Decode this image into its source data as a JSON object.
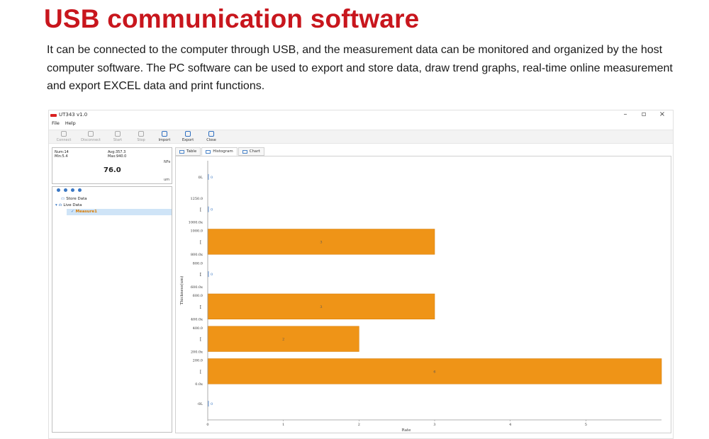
{
  "headline": "USB communication software",
  "description": "It can be connected to the computer through USB, and the measurement data can be monitored and organized by the host computer software. The PC software can be used to export and store data, draw trend graphs, real-time online measurement and export EXCEL data and print functions.",
  "window": {
    "title": "UT343 v1.0",
    "controls": {
      "minimize": "–",
      "maximize": "▫",
      "close": "×"
    }
  },
  "menu": [
    "File",
    "Help"
  ],
  "toolbar": [
    {
      "label": "Connect",
      "enabled": false
    },
    {
      "label": "Disconnect",
      "enabled": false
    },
    {
      "label": "Start",
      "enabled": false
    },
    {
      "label": "Stop",
      "enabled": false
    },
    {
      "label": "Import",
      "enabled": true
    },
    {
      "label": "Export",
      "enabled": true
    },
    {
      "label": "Close",
      "enabled": true
    }
  ],
  "measurement": {
    "num": "Num:14",
    "min": "Min:5.4",
    "avg": "Avg:357.3",
    "max": "Max:940.0",
    "mode": "NFe",
    "value": "76.0",
    "unit": "um"
  },
  "tree": {
    "store_data": "Store Data",
    "live_data": "Live Data",
    "measure": "Measure1"
  },
  "tabs": [
    "Table",
    "Histogram",
    "Chart"
  ],
  "chart_data": {
    "type": "bar",
    "orientation": "horizontal",
    "xlabel": "Rate",
    "ylabel": "Thickness(um)",
    "x_ticks": [
      "0",
      "1",
      "2",
      "3",
      "4",
      "5"
    ],
    "xlim": [
      0,
      6
    ],
    "categories": [
      {
        "upper": "-0L",
        "lower": "",
        "value": 0,
        "label": "0"
      },
      {
        "upper": "200.0",
        "lower": "0.0x",
        "value": 6,
        "label": "6"
      },
      {
        "upper": "400.0",
        "lower": "200.0x",
        "value": 2,
        "label": "2"
      },
      {
        "upper": "600.0",
        "lower": "400.0x",
        "value": 3,
        "label": "3"
      },
      {
        "upper": "800.0",
        "lower": "600.0x",
        "value": 0,
        "label": "0"
      },
      {
        "upper": "1000.0",
        "lower": "800.0x",
        "value": 3,
        "label": "3"
      },
      {
        "upper": "1250.0",
        "lower": "1000.0x",
        "value": 0,
        "label": "0"
      },
      {
        "upper": "0L",
        "lower": "",
        "value": 0,
        "label": "0"
      }
    ],
    "bar_color": "#ef9417",
    "grid": false
  }
}
